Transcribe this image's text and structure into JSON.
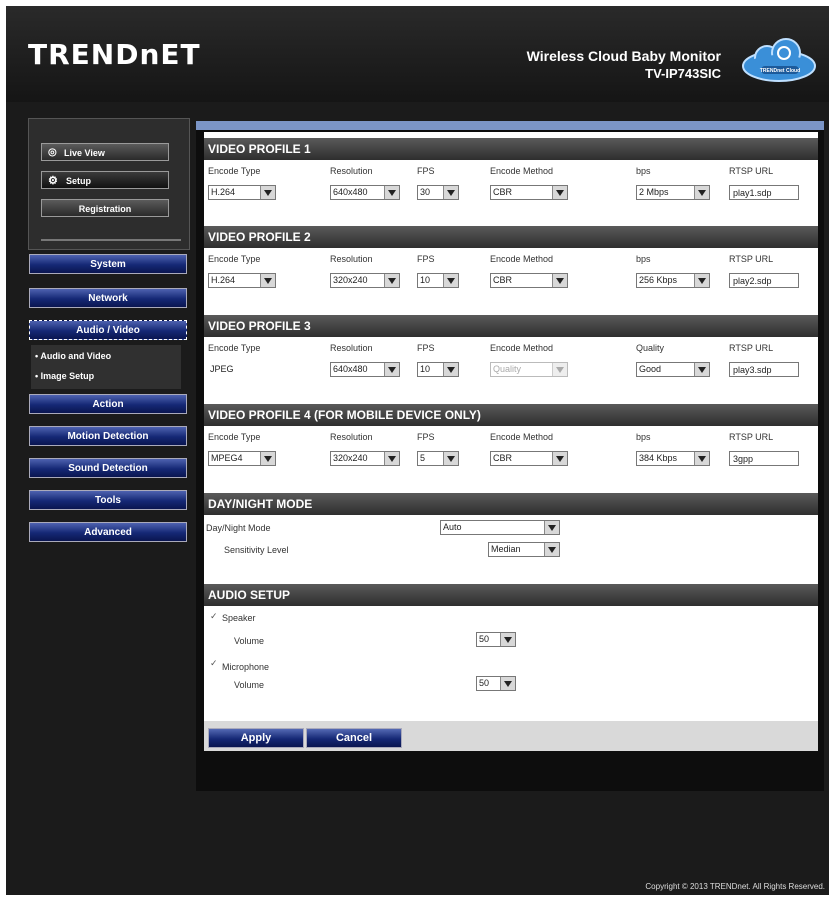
{
  "header": {
    "logo": "TRENDnET",
    "product_name": "Wireless Cloud Baby Monitor",
    "model": "TV-IP743SIC",
    "cloud_badge": "TRENDnet Cloud"
  },
  "sidebar": {
    "top_buttons": [
      {
        "label": "Live View"
      },
      {
        "label": "Setup"
      },
      {
        "label": "Registration"
      }
    ],
    "nav": [
      {
        "label": "System"
      },
      {
        "label": "Network"
      },
      {
        "label": "Audio / Video"
      },
      {
        "label": "Action"
      },
      {
        "label": "Motion Detection"
      },
      {
        "label": "Sound Detection"
      },
      {
        "label": "Tools"
      },
      {
        "label": "Advanced"
      }
    ],
    "submenu": [
      {
        "label": "• Audio and Video"
      },
      {
        "label": "• Image Setup"
      }
    ]
  },
  "profiles": [
    {
      "title": "VIDEO PROFILE 1",
      "headers": [
        "Encode Type",
        "Resolution",
        "FPS",
        "Encode Method",
        "bps",
        "RTSP URL"
      ],
      "encode_type": "H.264",
      "resolution": "640x480",
      "fps": "30",
      "encode_method": "CBR",
      "bps": "2 Mbps",
      "rtsp": "play1.sdp"
    },
    {
      "title": "VIDEO PROFILE 2",
      "headers": [
        "Encode Type",
        "Resolution",
        "FPS",
        "Encode Method",
        "bps",
        "RTSP URL"
      ],
      "encode_type": "H.264",
      "resolution": "320x240",
      "fps": "10",
      "encode_method": "CBR",
      "bps": "256 Kbps",
      "rtsp": "play2.sdp"
    },
    {
      "title": "VIDEO PROFILE 3",
      "headers": [
        "Encode Type",
        "Resolution",
        "FPS",
        "Encode Method",
        "Quality",
        "RTSP URL"
      ],
      "encode_type": "JPEG",
      "resolution": "640x480",
      "fps": "10",
      "encode_method": "Quality",
      "bps": "Good",
      "rtsp": "play3.sdp"
    },
    {
      "title": "VIDEO PROFILE 4 (FOR MOBILE DEVICE ONLY)",
      "headers": [
        "Encode Type",
        "Resolution",
        "FPS",
        "Encode Method",
        "bps",
        "RTSP URL"
      ],
      "encode_type": "MPEG4",
      "resolution": "320x240",
      "fps": "5",
      "encode_method": "CBR",
      "bps": "384 Kbps",
      "rtsp": "3gpp"
    }
  ],
  "daynight": {
    "title": "DAY/NIGHT MODE",
    "mode_label": "Day/Night Mode",
    "mode_value": "Auto",
    "sens_label": "Sensitivity Level",
    "sens_value": "Median"
  },
  "audio": {
    "title": "AUDIO SETUP",
    "speaker_label": "Speaker",
    "speaker_volume_label": "Volume",
    "speaker_volume": "50",
    "mic_label": "Microphone",
    "mic_volume_label": "Volume",
    "mic_volume": "50"
  },
  "buttons": {
    "apply": "Apply",
    "cancel": "Cancel"
  },
  "footer": {
    "copyright": "Copyright © 2013 TRENDnet. All Rights Reserved."
  },
  "colors": {
    "nav_blue": "#152875",
    "topbar_blue": "#7b95c7",
    "section_header": "#3a3a3a"
  }
}
